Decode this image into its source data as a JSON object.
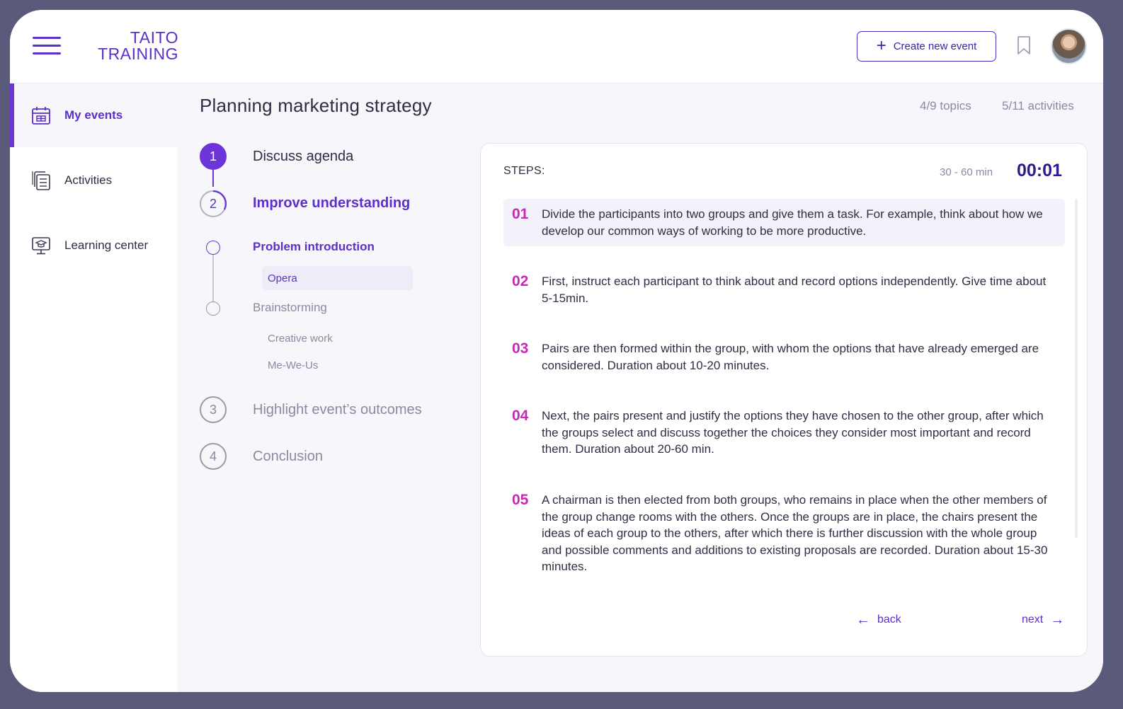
{
  "app": {
    "logo_line1": "TAITO",
    "logo_line2": "TRAINING"
  },
  "header": {
    "create_label": "Create new event"
  },
  "sidebar": {
    "items": [
      {
        "label": "My events",
        "icon": "calendar-icon",
        "active": true
      },
      {
        "label": "Activities",
        "icon": "activities-icon",
        "active": false
      },
      {
        "label": "Learning center",
        "icon": "learning-center-icon",
        "active": false
      }
    ]
  },
  "event": {
    "title": "Planning marketing strategy",
    "topics": "4/9 topics",
    "activities": "5/11 activities"
  },
  "timeline": {
    "steps": [
      {
        "num": "1",
        "label": "Discuss agenda",
        "state": "done"
      },
      {
        "num": "2",
        "label": "Improve understanding",
        "state": "current"
      },
      {
        "num": "3",
        "label": "Highlight event’s outcomes",
        "state": "upcoming"
      },
      {
        "num": "4",
        "label": "Conclusion",
        "state": "upcoming"
      }
    ],
    "subtopics": [
      {
        "label": "Problem introduction",
        "active": true,
        "activities": [
          "Opera"
        ]
      },
      {
        "label": "Brainstorming",
        "active": false,
        "activities": [
          "Creative work",
          "Me-We-Us"
        ]
      }
    ]
  },
  "steps_panel": {
    "title": "STEPS:",
    "duration": "30 - 60 min",
    "timer": "00:01",
    "items": [
      {
        "num": "01",
        "text": "Divide the participants into two groups and give them a task. For example, think about how we develop our common ways of working to be more productive."
      },
      {
        "num": "02",
        "text": "First, instruct each participant to think about and record options independently. Give time about 5-15min."
      },
      {
        "num": "03",
        "text": "Pairs are then formed within the group, with whom the options that have already emerged are considered. Duration about 10-20 minutes."
      },
      {
        "num": "04",
        "text": "Next, the pairs present and justify the options they have chosen to the other group, after which the groups select and discuss together the choices they consider most important and record them. Duration about 20-60 min."
      },
      {
        "num": "05",
        "text": "A chairman is then elected from both groups, who remains in place when the other members of the group change rooms with the others. Once the groups are in place, the chairs present the ideas of each group to the others, after which there is further discussion with the whole group and possible comments and additions to existing proposals are recorded. Duration about 15-30 minutes."
      }
    ],
    "back_label": "back",
    "next_label": "next"
  },
  "colors": {
    "accent": "#5b2fc9",
    "step_number": "#c52ab5",
    "timer": "#2a1c8f"
  }
}
